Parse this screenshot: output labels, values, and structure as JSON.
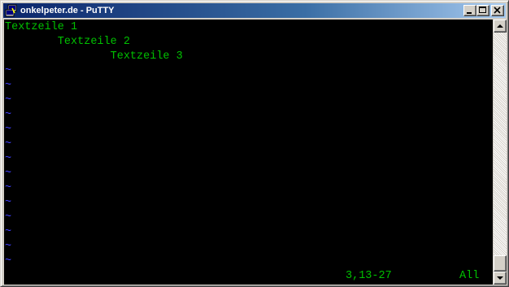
{
  "window": {
    "title": "onkelpeter.de - PuTTY",
    "icon": "putty-icon",
    "title_color": "#0a246a"
  },
  "terminal": {
    "lines": [
      "Textzeile 1",
      "        Textzeile 2",
      "                Textzeile 3"
    ],
    "empty_marker": "~",
    "status_position": "3,13-27",
    "status_scroll": "All",
    "text_color": "#00c000",
    "tilde_color": "#4040ff",
    "background": "#000000"
  }
}
